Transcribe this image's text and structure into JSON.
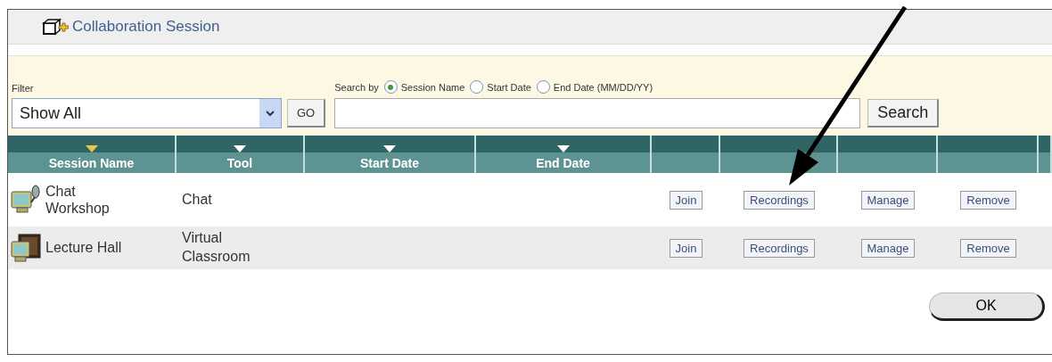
{
  "window": {
    "title": "Collaboration Session"
  },
  "filter": {
    "label": "Filter",
    "value": "Show All",
    "go_button": "GO"
  },
  "search": {
    "label": "Search by",
    "options": [
      {
        "label": "Session Name",
        "selected": true
      },
      {
        "label": "Start Date",
        "selected": false
      },
      {
        "label": "End Date (MM/DD/YY)",
        "selected": false
      }
    ],
    "button": "Search"
  },
  "table": {
    "columns": [
      {
        "label": "Session Name",
        "sorted": true
      },
      {
        "label": "Tool",
        "sorted": false
      },
      {
        "label": "Start Date",
        "sorted": false
      },
      {
        "label": "End Date",
        "sorted": false
      }
    ],
    "rows": [
      {
        "kind": "chat",
        "name": "Chat Workshop",
        "tool": "Chat",
        "actions": [
          "Join",
          "Recordings",
          "Manage",
          "Remove"
        ]
      },
      {
        "kind": "classroom",
        "name": "Lecture Hall",
        "tool": "Virtual Classroom",
        "actions": [
          "Join",
          "Recordings",
          "Manage",
          "Remove"
        ]
      }
    ]
  },
  "ok_button": "OK"
}
